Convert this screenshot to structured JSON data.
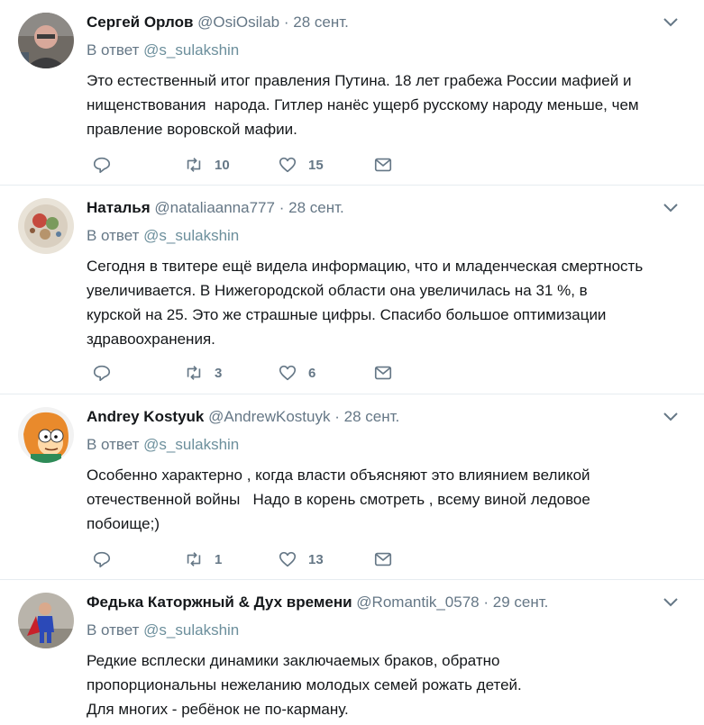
{
  "tweets": [
    {
      "name": "Сергей Орлов",
      "handle": "@OsiOsilab",
      "dot": "·",
      "time": "28 сент.",
      "reply_prefix": "В ответ ",
      "reply_to": "@s_sulakshin",
      "text": "Это естественный итог правления Путина. 18 лет грабежа России мафией и\nнищенствования  народа. Гитлер нанёс ущерб русскому народу меньше, чем\nправление воровской мафии.",
      "retweets": "10",
      "likes": "15",
      "replies": ""
    },
    {
      "name": "Наталья",
      "handle": "@nataliaanna777",
      "dot": "·",
      "time": "28 сент.",
      "reply_prefix": "В ответ ",
      "reply_to": "@s_sulakshin",
      "text": "Сегодня в твитере ещё видела информацию, что и младенческая смертность\nувеличивается. В Нижегородской области она увеличилась на 31 %, в\nкурской на 25. Это же страшные цифры. Спасибо большое оптимизации\nздравоохранения.",
      "retweets": "3",
      "likes": "6",
      "replies": ""
    },
    {
      "name": "Andrey Kostyuk",
      "handle": "@AndrewKostuyk",
      "dot": "·",
      "time": "28 сент.",
      "reply_prefix": "В ответ ",
      "reply_to": "@s_sulakshin",
      "text": "Особенно характерно , когда власти объясняют это влиянием великой\nотечественной войны   Надо в корень смотреть , всему виной ледовое\nпобоище;)",
      "retweets": "1",
      "likes": "13",
      "replies": ""
    },
    {
      "name": "Федька Каторжный & Дух времени",
      "handle": "@Romantik_0578",
      "dot": "·",
      "time": "29 сент.",
      "reply_prefix": "В ответ ",
      "reply_to": "@s_sulakshin",
      "text": "Редкие всплески динамики заключаемых браков, обратно\nпропорциональны нежеланию молодых семей рожать детей.\nДля многих - ребёнок не по-карману."
    }
  ],
  "colors": {
    "text": "#14171a",
    "secondary": "#657786",
    "mention": "#6c8f9c",
    "divider": "#e6ecf0"
  },
  "icons": [
    "avatar",
    "chevron-down-icon",
    "reply-icon",
    "retweet-icon",
    "like-icon",
    "message-icon"
  ]
}
